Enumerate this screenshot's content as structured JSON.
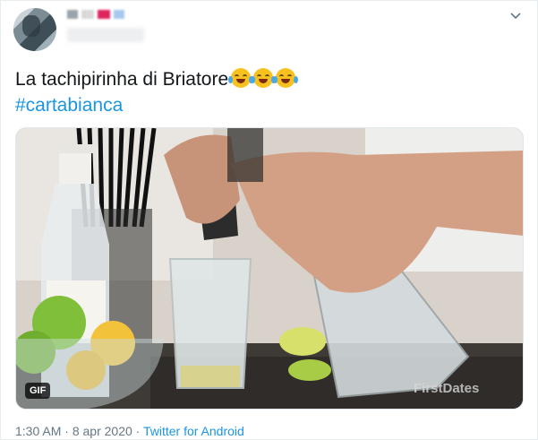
{
  "tweet": {
    "text": "La tachipirinha di Briatore",
    "emojis": [
      "face-with-tears-of-joy-icon",
      "face-with-tears-of-joy-icon",
      "face-with-tears-of-joy-icon"
    ],
    "hashtag": "#cartabianca"
  },
  "media": {
    "badge": "GIF",
    "watermark": "FirstDates"
  },
  "meta": {
    "time": "1:30 AM",
    "separator": " · ",
    "date": "8 apr 2020",
    "source": "Twitter for Android"
  },
  "colors": {
    "link": "#1b95e0",
    "text": "#14171a",
    "muted": "#657786"
  }
}
